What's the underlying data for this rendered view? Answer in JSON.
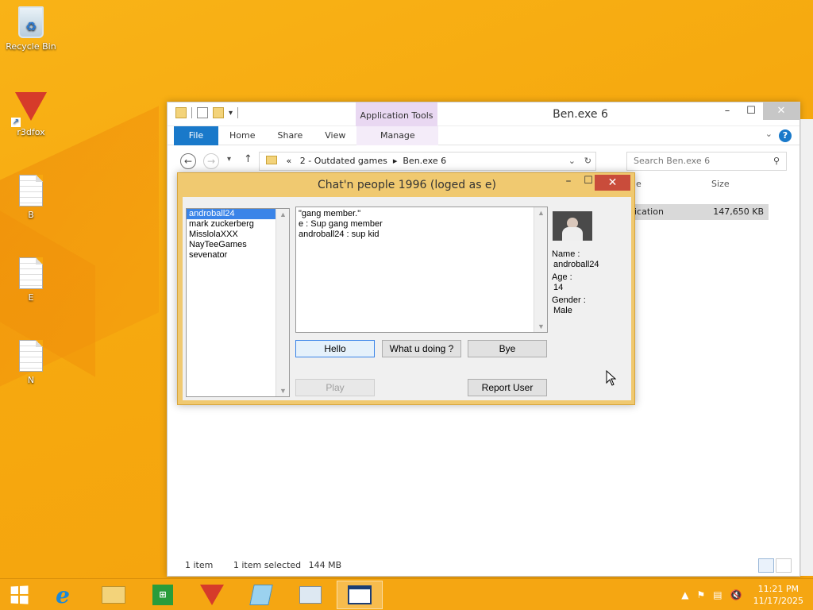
{
  "desktop": {
    "icons": [
      {
        "label": "Recycle Bin"
      },
      {
        "label": "r3dfox"
      },
      {
        "label": "B"
      },
      {
        "label": "E"
      },
      {
        "label": "N"
      }
    ]
  },
  "explorer": {
    "title": "Ben.exe 6",
    "contextual_group": "Application Tools",
    "tabs": {
      "file": "File",
      "home": "Home",
      "share": "Share",
      "view": "View",
      "manage": "Manage"
    },
    "address": {
      "prefix": "«",
      "crumb1": "2 - Outdated games",
      "sep": "▸",
      "crumb2": "Ben.exe 6"
    },
    "search_placeholder": "Search Ben.exe 6",
    "columns": {
      "name_partial": "e",
      "size": "Size"
    },
    "file_row": {
      "type_partial": "ication",
      "size": "147,650 KB"
    },
    "status": {
      "count": "1 item",
      "selected": "1 item selected",
      "size": "144 MB"
    }
  },
  "chat": {
    "title": "Chat'n people 1996 (loged as e)",
    "users": [
      "androball24",
      "mark zuckerberg",
      "MisslolaXXX",
      "NayTeeGames",
      "sevenator"
    ],
    "selected_user_index": 0,
    "messages": [
      "\"gang member.\"",
      "e : Sup gang member",
      "androball24 : sup kid"
    ],
    "buttons": {
      "hello": "Hello",
      "what": "What u doing ?",
      "bye": "Bye",
      "play": "Play",
      "report": "Report User"
    },
    "profile": {
      "name_label": "Name :",
      "name": "androball24",
      "age_label": "Age :",
      "age": "14",
      "gender_label": "Gender :",
      "gender": "Male"
    }
  },
  "taskbar": {
    "time": "11:21 PM",
    "date": "11/17/2025"
  },
  "colors": {
    "taskbar": "#f5a612",
    "desktop": "#f9b317",
    "chat_frame": "#f0c970",
    "accent_blue": "#1979ca"
  }
}
